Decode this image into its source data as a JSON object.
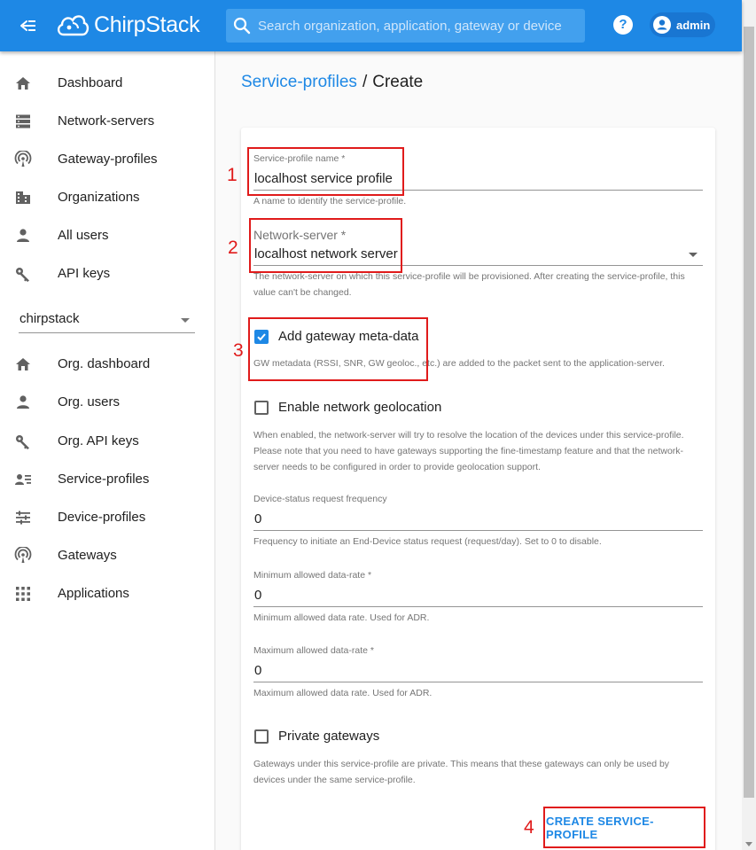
{
  "topbar": {
    "brand": "ChirpStack",
    "search_placeholder": "Search organization, application, gateway or device",
    "help_label": "?",
    "user": "admin"
  },
  "sidebar": {
    "global_items": [
      {
        "label": "Dashboard",
        "icon": "home-icon"
      },
      {
        "label": "Network-servers",
        "icon": "server-icon"
      },
      {
        "label": "Gateway-profiles",
        "icon": "gateway-icon"
      },
      {
        "label": "Organizations",
        "icon": "domain-icon"
      },
      {
        "label": "All users",
        "icon": "user-icon"
      },
      {
        "label": "API keys",
        "icon": "key-icon"
      }
    ],
    "org_selector": "chirpstack",
    "org_items": [
      {
        "label": "Org. dashboard",
        "icon": "home-icon"
      },
      {
        "label": "Org. users",
        "icon": "user-icon"
      },
      {
        "label": "Org. API keys",
        "icon": "key-icon"
      },
      {
        "label": "Service-profiles",
        "icon": "account-details-icon"
      },
      {
        "label": "Device-profiles",
        "icon": "tune-icon"
      },
      {
        "label": "Gateways",
        "icon": "gateway-icon"
      },
      {
        "label": "Applications",
        "icon": "apps-icon"
      }
    ]
  },
  "breadcrumb": {
    "parent": "Service-profiles",
    "separator": "/",
    "current": "Create"
  },
  "form": {
    "sp_name_label": "Service-profile name *",
    "sp_name_value": "localhost service profile",
    "sp_name_helper": "A name to identify the service-profile.",
    "ns_label": "Network-server *",
    "ns_value": "localhost network server",
    "ns_helper": "The network-server on which this service-profile will be provisioned. After creating the service-profile, this value can't be changed.",
    "gw_meta_label": "Add gateway meta-data",
    "gw_meta_checked": true,
    "gw_meta_helper": "GW metadata (RSSI, SNR, GW geoloc., etc.) are added to the packet sent to the application-server.",
    "geo_label": "Enable network geolocation",
    "geo_checked": false,
    "geo_helper": "When enabled, the network-server will try to resolve the location of the devices under this service-profile. Please note that you need to have gateways supporting the fine-timestamp feature and that the network-server needs to be configured in order to provide geolocation support.",
    "dev_status_label": "Device-status request frequency",
    "dev_status_value": "0",
    "dev_status_helper": "Frequency to initiate an End-Device status request (request/day). Set to 0 to disable.",
    "min_dr_label": "Minimum allowed data-rate *",
    "min_dr_value": "0",
    "min_dr_helper": "Minimum allowed data rate. Used for ADR.",
    "max_dr_label": "Maximum allowed data-rate *",
    "max_dr_value": "0",
    "max_dr_helper": "Maximum allowed data rate. Used for ADR.",
    "private_gw_label": "Private gateways",
    "private_gw_checked": false,
    "private_gw_helper": "Gateways under this service-profile are private. This means that these gateways can only be used by devices under the same service-profile.",
    "submit_label": "CREATE SERVICE-PROFILE"
  },
  "annotations": [
    "1",
    "2",
    "3",
    "4"
  ],
  "colors": {
    "primary": "#1e88e5",
    "annotation": "#e01b1b"
  }
}
